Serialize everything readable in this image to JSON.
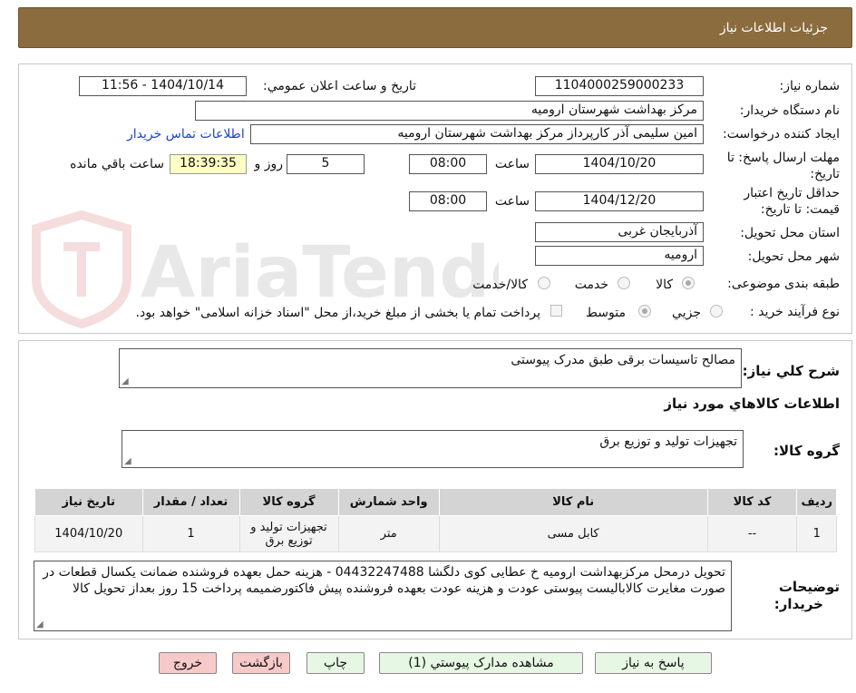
{
  "header": {
    "title": "جزئیات اطلاعات نیاز"
  },
  "watermark": {
    "text": "AriaTender.net"
  },
  "form": {
    "need_number_label": "شماره نیاز:",
    "need_number": "1104000259000233",
    "announce_label": "تاریخ و ساعت اعلان عمومي:",
    "announce_value": "1404/10/14 - 11:56",
    "buyer_org_label": "نام دستگاه خريدار:",
    "buyer_org": "مرکز بهداشت شهرستان ارومیه",
    "requester_label": "ايجاد کننده درخواست:",
    "requester": "امین سلیمی آذر کارپرداز مرکز بهداشت شهرستان ارومیه",
    "contact_link": "اطلاعات تماس خريدار",
    "reply_deadline_label_1": "مهلت ارسال پاسخ: تا",
    "reply_deadline_label_2": "تاريخ:",
    "reply_date": "1404/10/20",
    "time_label": "ساعت",
    "reply_time": "08:00",
    "days_value": "5",
    "days_label": "روز و",
    "remaining_time": "18:39:35",
    "remaining_label": "ساعت باقي مانده",
    "validity_label_1": "حداقل تاريخ اعتبار",
    "validity_label_2": "قيمت: تا تاريخ:",
    "validity_date": "1404/12/20",
    "validity_time": "08:00",
    "province_label": "استان محل تحويل:",
    "province": "آذربايجان غربی",
    "city_label": "شهر محل تحويل:",
    "city": "ارومیه",
    "category_label": "طبقه بندی موضوعی:",
    "category_options": [
      "کالا",
      "خدمت",
      "کالا/خدمت"
    ],
    "process_label": "نوع فرآیند خرید :",
    "process_options": [
      "جزيي",
      "متوسط"
    ],
    "payment_note": "پرداخت تمام یا بخشی از مبلغ خرید،از محل \"اسناد خزانه اسلامی\" خواهد بود."
  },
  "details": {
    "summary_label": "شرح کلي نياز:",
    "summary": "مصالح تاسیسات برقی طبق مدرک پیوستی",
    "goods_info_title": "اطلاعات کالاهاي مورد نياز",
    "goods_group_label": "گروه کالا:",
    "goods_group": "تجهیزات تولید و توزیع برق",
    "table": {
      "headers": [
        "رديف",
        "کد کالا",
        "نام کالا",
        "واحد شمارش",
        "گروه کالا",
        "تعداد / مقدار",
        "تاريخ نياز"
      ],
      "rows": [
        [
          "1",
          "--",
          "کابل مسی",
          "متر",
          "تجهیزات تولید و توزیع برق",
          "1",
          "1404/10/20"
        ]
      ]
    },
    "buyer_notes_label_1": "توضيحات",
    "buyer_notes_label_2": "خريدار:",
    "buyer_notes": "تحویل درمحل مرکزبهداشت ارومیه خ عطایی کوی دلگشا 04432247488 - هزینه حمل بعهده فروشنده ضمانت یکسال قطعات در صورت مغایرت کالابالیست پیوستی عودت و هزینه عودت بعهده فروشنده پیش فاکتورضمیمه پرداخت 15 روز بعداز تحویل کالا"
  },
  "buttons": {
    "reply": "پاسخ به نياز",
    "view_docs": "مشاهده مدارک پيوستي (1)",
    "print": "چاپ",
    "back": "بازگشت",
    "exit": "خروج"
  },
  "colors": {
    "header_bg": "#8b6c3e",
    "link": "#1d44c8",
    "timer_bg": "#ffffc4",
    "green_btn": "#e6f7e3",
    "pink_btn": "#f8c9c9"
  }
}
